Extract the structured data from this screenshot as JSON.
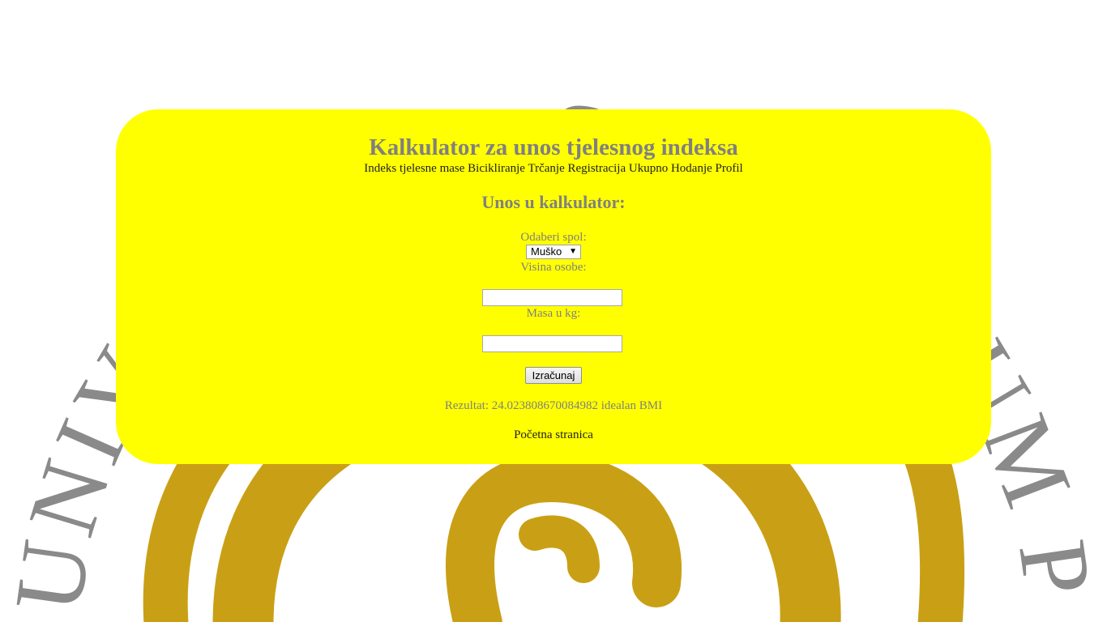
{
  "page": {
    "title": "Kalkulator za unos tjelesnog indeksa",
    "background_seal_text": "UNIVERSITAS STUDIORUM POLENSIS · GEORGIUS DOBRILA"
  },
  "nav": {
    "items": [
      "Indeks tjelesne mase",
      "Bicikliranje",
      "Trčanje",
      "Registracija",
      "Ukupno",
      "Hodanje",
      "Profil"
    ]
  },
  "form": {
    "heading": "Unos u kalkulator:",
    "gender_label": "Odaberi spol:",
    "gender_selected": "Muško",
    "height_label": "Visina osobe:",
    "height_value": "",
    "mass_label": "Masa u kg:",
    "mass_value": "",
    "submit_label": "Izračunaj"
  },
  "result": {
    "text": "Rezultat: 24.023808670084982 idealan BMI"
  },
  "footer": {
    "home_link": "Početna stranica"
  },
  "colors": {
    "card_bg": "#ffff00",
    "heading_gray": "#808080",
    "seal_gray": "#8a8a8a",
    "seal_gold": "#c9a015"
  }
}
